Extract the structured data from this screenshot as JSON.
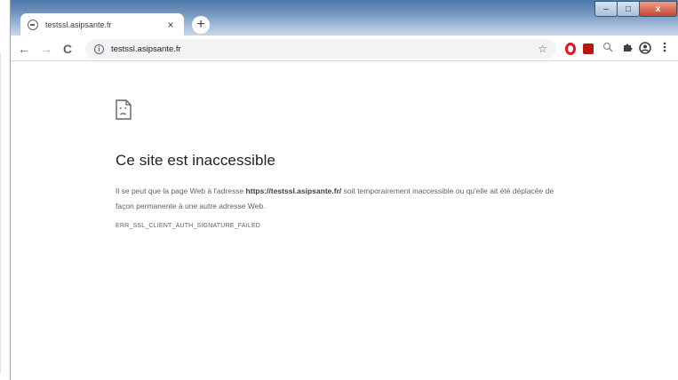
{
  "tab": {
    "title": "testssl.asipsante.fr",
    "close_label": "×"
  },
  "new_tab_label": "+",
  "window_controls": {
    "minimize": "–",
    "maximize": "□",
    "close": "x"
  },
  "nav": {
    "back": "←",
    "forward": "→",
    "reload": "C"
  },
  "omnibox": {
    "info": "i",
    "url": "testssl.asipsante.fr",
    "star": "☆"
  },
  "extensions": [
    "opera-icon",
    "pdf-icon",
    "zoom-icon",
    "puzzle-icon",
    "account-icon",
    "menu-icon"
  ],
  "error": {
    "heading": "Ce site est inaccessible",
    "para_prefix": "Il se peut que la page Web à l'adresse ",
    "para_url": "https://testssl.asipsante.fr/",
    "para_suffix": " soit temporairement inaccessible ou qu'elle ait été déplacée de façon permanente à une autre adresse Web.",
    "code": "ERR_SSL_CLIENT_AUTH_SIGNATURE_FAILED"
  },
  "colors": {
    "title_bar": "#6a8fb9",
    "opera_red": "#e0161b",
    "pdf_red": "#b3180c"
  }
}
